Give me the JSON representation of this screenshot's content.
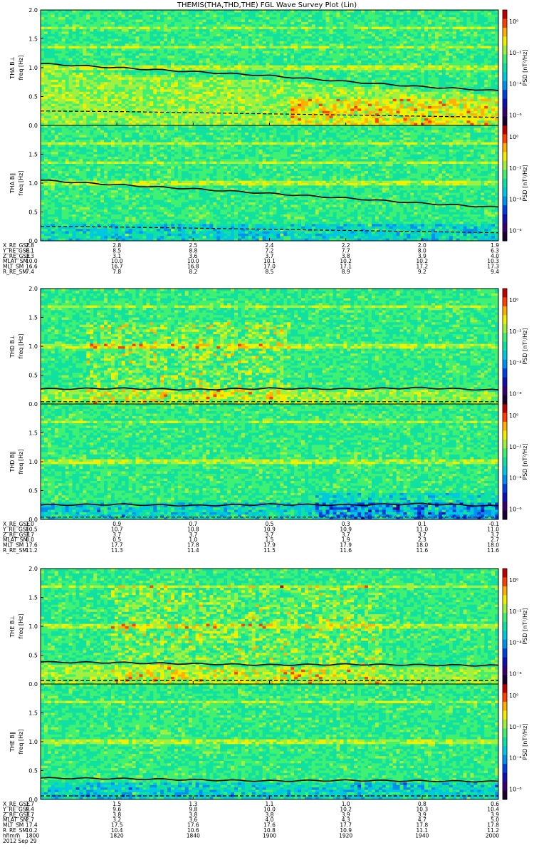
{
  "title": "THEMIS(THA,THD,THE) FGL Wave Survey Plot (Lin)",
  "colors": {
    "bg": "#ffffff",
    "colormap": [
      "#1a0033",
      "#3a0070",
      "#1010b0",
      "#0040e0",
      "#0090f0",
      "#00c8e0",
      "#10e0a0",
      "#40f070",
      "#a0f040",
      "#f0f000",
      "#ffb000",
      "#ff4000",
      "#c00000"
    ],
    "line": "#000000"
  },
  "colorbar_label": "PSD [nT²/Hz]",
  "colorbar_ticks": [
    "10⁰",
    "10⁻²",
    "10⁻⁴",
    "10⁻⁶"
  ],
  "colorbar_ticks_b": [
    "10⁰",
    "10⁻²",
    "10⁻⁴",
    "10⁻⁶"
  ],
  "y_axis_title": "freq [Hz]",
  "y_ticks": [
    "2.0",
    "1.5",
    "1.0",
    "0.5",
    "0.0"
  ],
  "eph_labels": [
    "X_RE_GSE",
    "Y_RE_GSE",
    "Z_RE_GSE",
    "MLAT_SM",
    "MLT_SM",
    "R_RE_SM"
  ],
  "time_label_row": "hhmm",
  "date_label": "2012 Sep 29",
  "x_times": [
    "1800",
    "1820",
    "1840",
    "1900",
    "1920",
    "1940",
    "2000"
  ],
  "chart_data": [
    {
      "type": "heatmap",
      "probe": "THA",
      "panels": [
        "THA B⊥",
        "THA B∥"
      ],
      "ylabel": "freq [Hz]",
      "ylim": [
        0,
        2.0
      ],
      "zscale": "log",
      "fce_solid": [
        1.07,
        1.0,
        0.93,
        0.86,
        0.76,
        0.67,
        0.6
      ],
      "fce_solid_b": [
        1.05,
        0.97,
        0.9,
        0.82,
        0.74,
        0.65,
        0.58
      ],
      "half_dashed": [
        0.25,
        0.24,
        0.22,
        0.2,
        0.18,
        0.16,
        0.14
      ],
      "ephemeris": {
        "X_RE_GSE": [
          "2.8",
          "2.8",
          "2.5",
          "2.4",
          "2.2",
          "2.0",
          "1.9"
        ],
        "Y_RE_GSE": [
          "8.1",
          "8.5",
          "8.8",
          "7.2",
          "7.7",
          "8.0",
          "6.3"
        ],
        "Z_RE_GSE": [
          "3.3",
          "3.1",
          "3.6",
          "3.7",
          "3.8",
          "3.9",
          "4.0"
        ],
        "MLAT_SM": [
          "10.0",
          "10.0",
          "10.0",
          "10.1",
          "10.2",
          "10.2",
          "10.3"
        ],
        "MLT_SM": [
          "16.6",
          "16.7",
          "16.8",
          "17.0",
          "17.1",
          "17.2",
          "17.3"
        ],
        "R_RE_SM": [
          "7.4",
          "7.8",
          "8.2",
          "8.5",
          "8.9",
          "9.2",
          "9.4"
        ]
      }
    },
    {
      "type": "heatmap",
      "probe": "THD",
      "panels": [
        "THD B⊥",
        "THD B∥"
      ],
      "ylabel": "freq [Hz]",
      "ylim": [
        0,
        2.0
      ],
      "zscale": "log",
      "fce_solid": [
        0.26,
        0.27,
        0.25,
        0.27,
        0.26,
        0.28,
        0.24
      ],
      "fce_solid_b": [
        0.25,
        0.26,
        0.24,
        0.26,
        0.25,
        0.27,
        0.23
      ],
      "half_dashed": [
        0.04,
        0.04,
        0.04,
        0.04,
        0.04,
        0.04,
        0.04
      ],
      "ephemeris": {
        "X_RE_GSE": [
          "1.0",
          "0.9",
          "0.7",
          "0.5",
          "0.3",
          "0.1",
          "-0.1"
        ],
        "Y_RE_GSE": [
          "10.5",
          "10.7",
          "10.8",
          "10.9",
          "10.9",
          "11.0",
          "11.0"
        ],
        "Z_RE_GSE": [
          "3.7",
          "3.7",
          "3.7",
          "3.7",
          "3.7",
          "3.7",
          "3.7"
        ],
        "MLAT_SM": [
          "0.0",
          "0.5",
          "1.0",
          "1.5",
          "1.9",
          "2.3",
          "2.7"
        ],
        "MLT_SM": [
          "17.6",
          "17.7",
          "17.8",
          "17.9",
          "17.9",
          "18.0",
          "18.0"
        ],
        "R_RE_SM": [
          "11.2",
          "11.3",
          "11.4",
          "11.5",
          "11.6",
          "11.6",
          "11.6"
        ]
      }
    },
    {
      "type": "heatmap",
      "probe": "THE",
      "panels": [
        "THE B⊥",
        "THE B∥"
      ],
      "ylabel": "freq [Hz]",
      "ylim": [
        0,
        2.0
      ],
      "zscale": "log",
      "fce_solid": [
        0.38,
        0.37,
        0.35,
        0.33,
        0.34,
        0.33,
        0.32
      ],
      "fce_solid_b": [
        0.37,
        0.36,
        0.34,
        0.32,
        0.33,
        0.32,
        0.31
      ],
      "half_dashed": [
        0.06,
        0.06,
        0.06,
        0.06,
        0.06,
        0.06,
        0.06
      ],
      "ephemeris": {
        "X_RE_GSE": [
          "1.7",
          "1.5",
          "1.3",
          "1.1",
          "1.0",
          "0.8",
          "0.6"
        ],
        "Y_RE_GSE": [
          "9.4",
          "9.6",
          "9.8",
          "10.0",
          "10.2",
          "10.3",
          "10.4"
        ],
        "Z_RE_GSE": [
          "3.7",
          "3.8",
          "3.8",
          "3.8",
          "3.9",
          "3.9",
          "3.9"
        ],
        "MLAT_SM": [
          "2.7",
          "3.2",
          "3.6",
          "4.0",
          "4.3",
          "4.7",
          "5.0"
        ],
        "MLT_SM": [
          "17.4",
          "17.5",
          "17.6",
          "17.6",
          "17.7",
          "17.8",
          "17.8"
        ],
        "R_RE_SM": [
          "10.2",
          "10.4",
          "10.6",
          "10.8",
          "10.9",
          "11.1",
          "11.2"
        ],
        "hhmm": [
          "1800",
          "1820",
          "1840",
          "1900",
          "1920",
          "1940",
          "2000"
        ]
      }
    }
  ]
}
